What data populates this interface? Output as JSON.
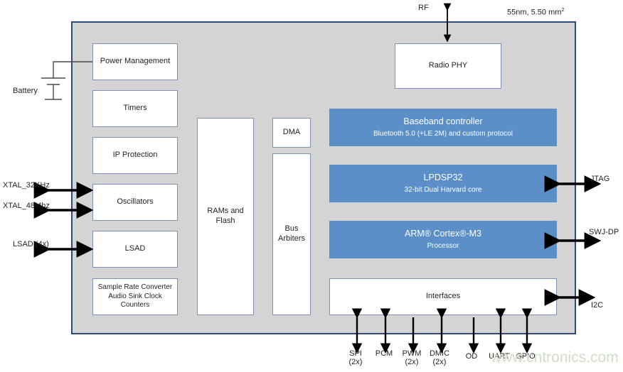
{
  "diagram": {
    "title_note": "55nm, 5.50 mm",
    "title_note_sup": "2",
    "watermark": "www.cntronics.com"
  },
  "left_column": {
    "blocks": [
      {
        "id": "power-management",
        "label": "Power Management"
      },
      {
        "id": "timers",
        "label": "Timers"
      },
      {
        "id": "ip-protection",
        "label": "IP Protection"
      },
      {
        "id": "oscillators",
        "label": "Oscillators"
      },
      {
        "id": "lsad",
        "label": "LSAD"
      },
      {
        "id": "sample-rate-converter",
        "line1": "Sample Rate Converter",
        "line2": "Audio Sink Clock Counters"
      }
    ]
  },
  "memory_column": {
    "rams_and_flash": {
      "line1": "RAMs and",
      "line2": "Flash"
    }
  },
  "bus_column": {
    "dma": "DMA",
    "bus_arbiters": {
      "line1": "Bus",
      "line2": "Arbiters"
    }
  },
  "right_column": {
    "radio_phy": "Radio PHY",
    "baseband_controller": {
      "title": "Baseband controller",
      "subtitle": "Bluetooth 5.0 (+LE 2M) and custom protocol"
    },
    "lpdsp32": {
      "title": "LPDSP32",
      "subtitle": "32-bit Dual Harvard core"
    },
    "cortex_m3": {
      "title": "ARM® Cortex®-M3",
      "subtitle": "Processor"
    },
    "interfaces": "Interfaces"
  },
  "left_pins": [
    {
      "id": "battery",
      "label": "Battery"
    },
    {
      "id": "xtal-32khz",
      "label": "XTAL_32KHz"
    },
    {
      "id": "xtal-48mhz",
      "label": "XTAL_48Mhz"
    },
    {
      "id": "lsad-4x",
      "label": "LSAD (4x)"
    }
  ],
  "top_pins": [
    {
      "id": "rf",
      "label": "RF"
    }
  ],
  "right_pins": [
    {
      "id": "jtag",
      "label": "JTAG"
    },
    {
      "id": "swj-dp",
      "label": "SWJ-DP"
    },
    {
      "id": "i2c",
      "label": "I2C"
    }
  ],
  "bottom_pins": [
    {
      "id": "spi",
      "line1": "SPI",
      "line2": "(2x)"
    },
    {
      "id": "pcm",
      "line1": "PCM",
      "line2": ""
    },
    {
      "id": "pwm",
      "line1": "PWM",
      "line2": "(2x)"
    },
    {
      "id": "dmic",
      "line1": "DMIC",
      "line2": "(2x)"
    },
    {
      "id": "od",
      "line1": "OD",
      "line2": ""
    },
    {
      "id": "uart",
      "line1": "UART",
      "line2": ""
    },
    {
      "id": "gpio",
      "line1": "GPIO",
      "line2": ""
    }
  ],
  "colors": {
    "die_fill": "#d4d4d4",
    "die_border": "#2e4b7a",
    "block_border": "#7e93b4",
    "accent_blue": "#5b8fc7",
    "text": "#231f20",
    "watermark": "#cfe0c4"
  }
}
